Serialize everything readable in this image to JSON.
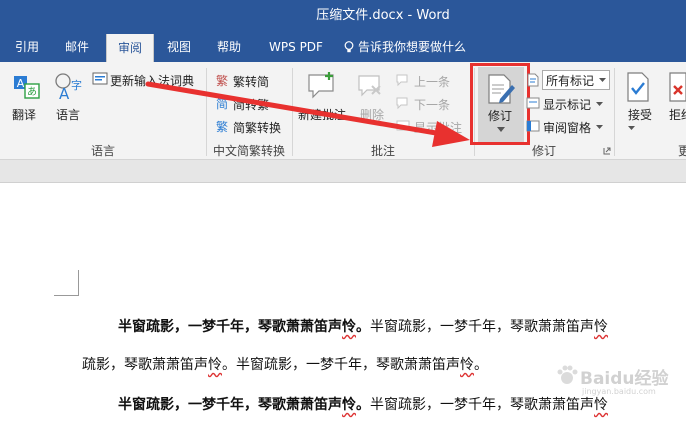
{
  "window": {
    "title": "压缩文件.docx  -  Word"
  },
  "tabs": [
    {
      "label": "引用"
    },
    {
      "label": "邮件"
    },
    {
      "label": "审阅"
    },
    {
      "label": "视图"
    },
    {
      "label": "帮助"
    },
    {
      "label": "WPS PDF"
    },
    {
      "label": "告诉我你想要做什么"
    }
  ],
  "ribbon": {
    "language_group": {
      "name": "语言",
      "translate": "翻译",
      "language": "语言",
      "update_dict": "更新输入法词典"
    },
    "chinese_group": {
      "name": "中文简繁转换",
      "to_simplified": "繁转简",
      "to_traditional": "简转繁",
      "convert": "简繁转换"
    },
    "comments_group": {
      "name": "批注",
      "new": "新建批注",
      "delete": "删除",
      "prev": "上一条",
      "next": "下一条",
      "show": "显示批注"
    },
    "tracking_group": {
      "name": "修订",
      "track_changes": "修订",
      "all_markup": "所有标记",
      "show_markup": "显示标记",
      "reviewing_pane": "审阅窗格"
    },
    "changes_group": {
      "accept": "接受",
      "reject": "拒绝",
      "clipped_label": "更"
    }
  },
  "document": {
    "p1_bold": "半窗疏影，一梦千年，琴歌萧萧笛声",
    "p1_bold_wavy": "怜",
    "p1_bold_end": "。",
    "p1_rest_a": "半窗疏影，一梦千年，琴歌萧萧笛声",
    "p1_rest_wavy": "怜",
    "p2_a": "疏影，琴歌萧萧笛声",
    "p2_wavy": "怜",
    "p2_b": "。半窗疏影，一梦千年，琴歌萧萧笛声",
    "p2_wavy2": "怜",
    "p2_end": "。",
    "p3_bold": "半窗疏影，一梦千年，琴歌萧萧笛声",
    "p3_bold_wavy": "怜",
    "p3_bold_end": "。",
    "p3_rest_a": "半窗疏影，一梦千年，琴歌萧萧笛声",
    "p3_rest_wavy": "怜"
  },
  "watermark": {
    "text": "Baidu经验",
    "sub": "jingyan.baidu.com"
  },
  "colors": {
    "accent": "#2b579a",
    "highlight": "#e8312f"
  }
}
